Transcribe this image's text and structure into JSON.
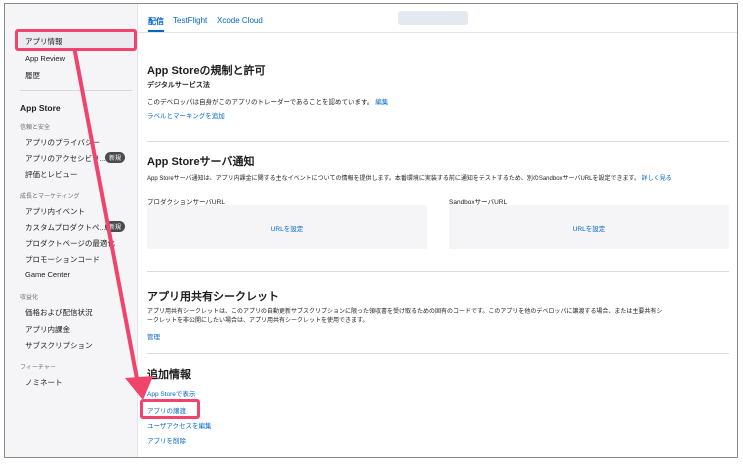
{
  "sidebar": {
    "app_info": "アプリ情報",
    "app_review": "App Review",
    "history": "履歴",
    "appstore_head": "App Store",
    "sec_trust": "信頼と安全",
    "privacy": "アプリのプライバシー",
    "accessibility": "アプリのアクセシビリ...",
    "ratings": "評価とレビュー",
    "badge_new": "新規",
    "sec_growth": "成長とマーケティング",
    "in_app_events": "アプリ内イベント",
    "custom_product": "カスタムプロダクトペ...",
    "product_opt": "プロダクトページの最適化",
    "promo_codes": "プロモーションコード",
    "game_center": "Game Center",
    "sec_monetize": "収益化",
    "pricing": "価格および配信状況",
    "iap": "アプリ内課金",
    "subscriptions": "サブスクリプション",
    "sec_featuring": "フィーチャー",
    "nominate": "ノミネート"
  },
  "tabs": {
    "distribution": "配信",
    "testflight": "TestFlight",
    "xcode_cloud": "Xcode Cloud"
  },
  "main": {
    "s1_title": "App Storeの規制と許可",
    "s1_sub": "デジタルサービス法",
    "s1_text": "このデベロッパは自身がこのアプリのトレーダーであることを認めています。",
    "s1_edit": "編集",
    "s1_link": "ラベルとマーキングを追加",
    "s2_title": "App Storeサーバ通知",
    "s2_text": "App Storeサーバ通知は、アプリ内課金に関する主なイベントについての情報を提供します。本番環境に実装する前に通知をテストするため、別のSandboxサーバURLを設定できます。",
    "s2_more": "詳しく見る",
    "prod_url_label": "プロダクションサーバURL",
    "sandbox_url_label": "SandboxサーバURL",
    "set_url": "URLを設定",
    "s3_title": "アプリ用共有シークレット",
    "s3_text1": "アプリ用共有シークレットは、このアプリの自動更新サブスクリプションに限った領収書を受け取るための固有のコードです。このアプリを他のデベロッパに譲渡する場合、または主要共有シ",
    "s3_text2": "ークレットを非公開にしたい場合は、アプリ用共有シークレットを使用できます。",
    "s3_manage": "管理",
    "s4_title": "追加情報",
    "view_appstore": "App Storeで表示",
    "transfer": "アプリの譲渡",
    "edit_access": "ユーザアクセスを編集",
    "delete": "アプリを削除"
  },
  "colors": {
    "accent": "#0066cc",
    "highlight": "#f0446c"
  }
}
